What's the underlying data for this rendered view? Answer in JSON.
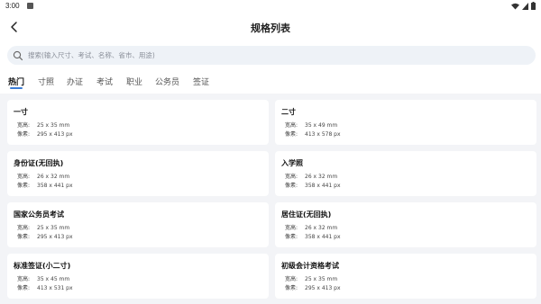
{
  "status_bar": {
    "time": "3:00"
  },
  "header": {
    "title": "规格列表"
  },
  "search": {
    "placeholder": "搜索(输入尺寸、考试、名称、省市、用途)"
  },
  "tabs": [
    {
      "label": "热门",
      "active": true
    },
    {
      "label": "寸照",
      "active": false
    },
    {
      "label": "办证",
      "active": false
    },
    {
      "label": "考试",
      "active": false
    },
    {
      "label": "职业",
      "active": false
    },
    {
      "label": "公务员",
      "active": false
    },
    {
      "label": "签证",
      "active": false
    }
  ],
  "labels": {
    "size": "宽高:",
    "pixels": "像素:"
  },
  "cards": [
    {
      "title": "一寸",
      "size": "25 x 35 mm",
      "pixels": "295 x 413 px"
    },
    {
      "title": "二寸",
      "size": "35 x 49 mm",
      "pixels": "413 x 578 px"
    },
    {
      "title": "身份证(无回执)",
      "size": "26 x 32 mm",
      "pixels": "358 x 441 px"
    },
    {
      "title": "入学照",
      "size": "26 x 32 mm",
      "pixels": "358 x 441 px"
    },
    {
      "title": "国家公务员考试",
      "size": "25 x 35 mm",
      "pixels": "295 x 413 px"
    },
    {
      "title": "居住证(无回执)",
      "size": "26 x 32 mm",
      "pixels": "358 x 441 px"
    },
    {
      "title": "标准签证(小二寸)",
      "size": "35 x 45 mm",
      "pixels": "413 x 531 px"
    },
    {
      "title": "初级会计资格考试",
      "size": "25 x 35 mm",
      "pixels": "295 x 413 px"
    }
  ],
  "colors": {
    "accent": "#3a7bd5",
    "background": "#f3f4f7",
    "search_bg": "#eef2f7"
  }
}
